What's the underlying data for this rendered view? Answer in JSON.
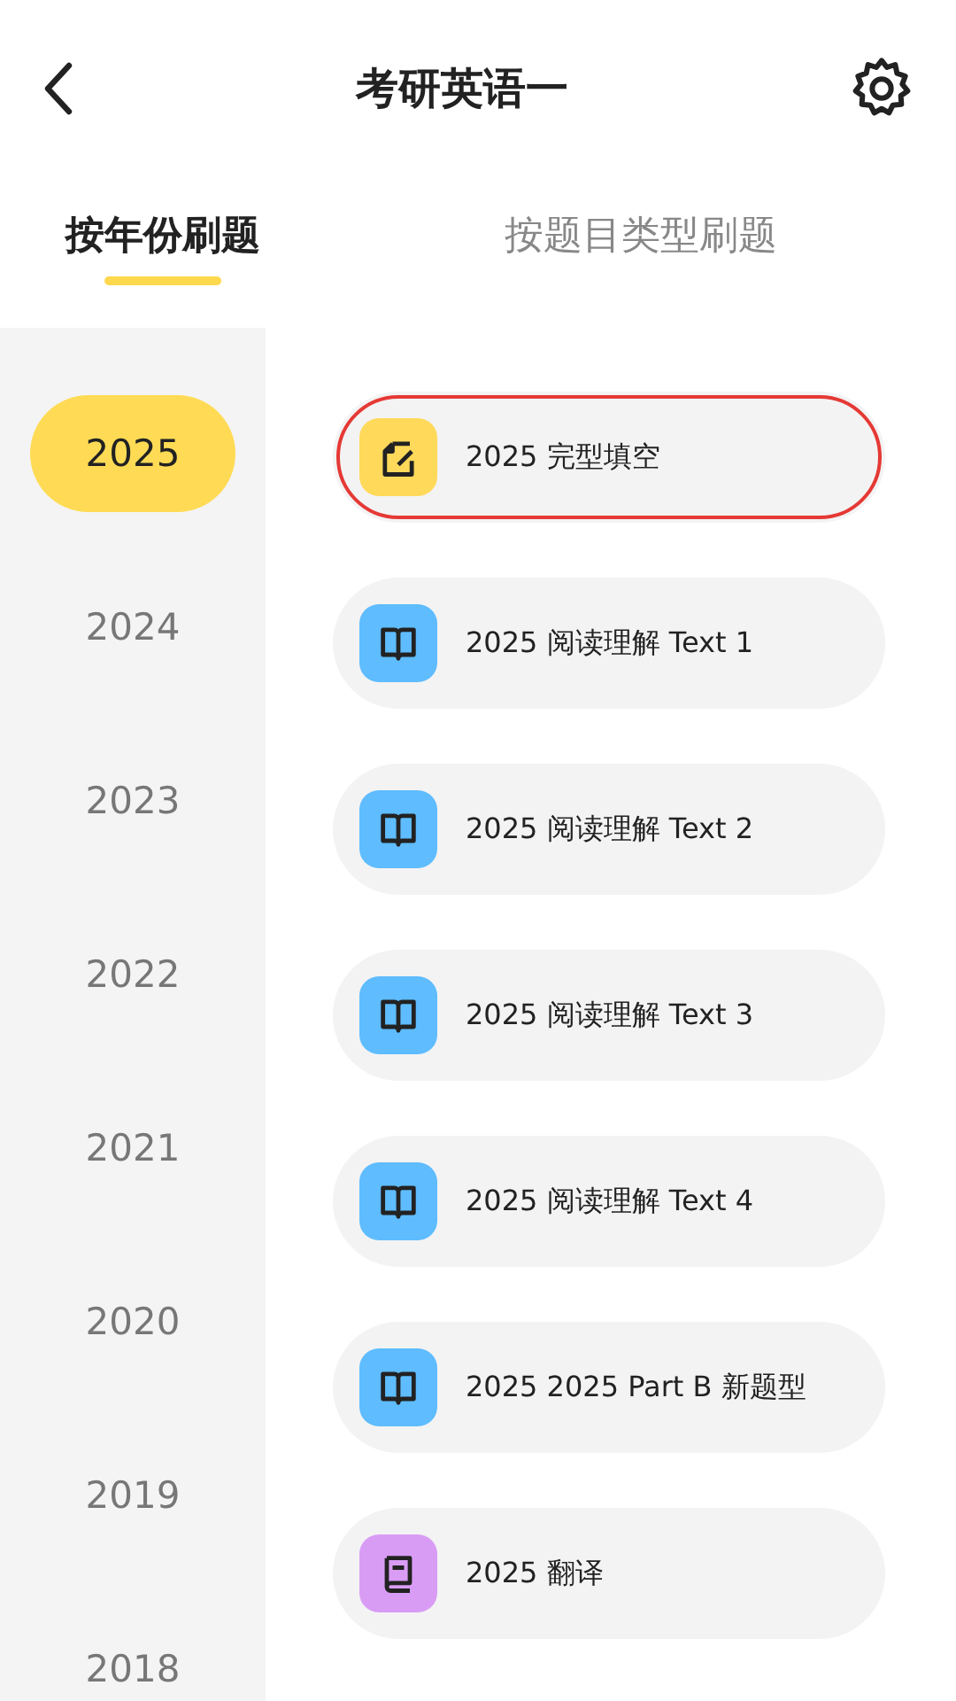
{
  "header": {
    "title": "考研英语一"
  },
  "tabs": [
    {
      "label": "按年份刷题",
      "selected": true
    },
    {
      "label": "按题目类型刷题",
      "selected": false
    }
  ],
  "years": [
    {
      "label": "2025",
      "selected": true
    },
    {
      "label": "2024",
      "selected": false
    },
    {
      "label": "2023",
      "selected": false
    },
    {
      "label": "2022",
      "selected": false
    },
    {
      "label": "2021",
      "selected": false
    },
    {
      "label": "2020",
      "selected": false
    },
    {
      "label": "2019",
      "selected": false
    },
    {
      "label": "2018",
      "selected": false
    }
  ],
  "items": [
    {
      "kind": "cloze",
      "label": "2025 完型填空",
      "highlighted": true
    },
    {
      "kind": "reading",
      "label": "2025 阅读理解 Text 1",
      "highlighted": false
    },
    {
      "kind": "reading",
      "label": "2025 阅读理解 Text 2",
      "highlighted": false
    },
    {
      "kind": "reading",
      "label": "2025 阅读理解 Text 3",
      "highlighted": false
    },
    {
      "kind": "reading",
      "label": "2025 阅读理解 Text 4",
      "highlighted": false
    },
    {
      "kind": "reading",
      "label": "2025 2025 Part B 新题型",
      "highlighted": false
    },
    {
      "kind": "translation",
      "label": "2025 翻译",
      "highlighted": false
    }
  ]
}
